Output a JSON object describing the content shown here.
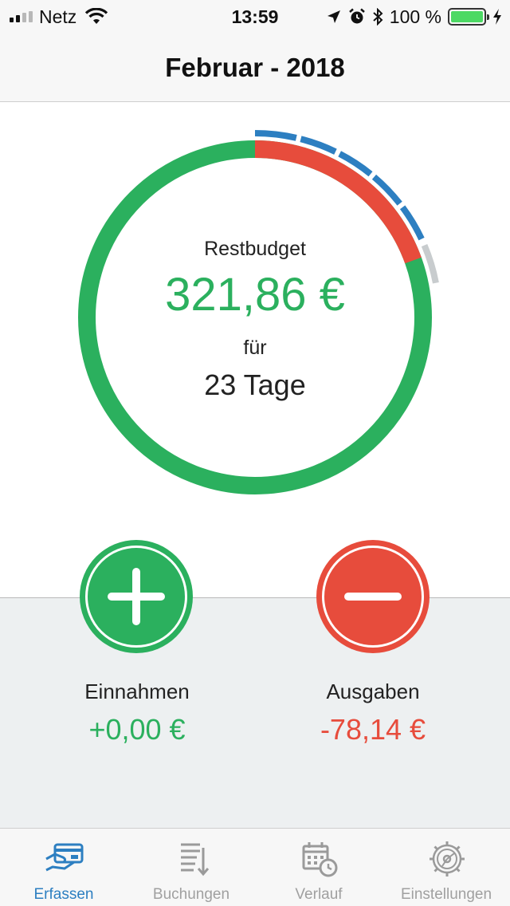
{
  "status_bar": {
    "carrier": "Netz",
    "time": "13:59",
    "battery_text": "100 %",
    "signal_bars": 4,
    "signal_bars_active": 2,
    "icons": [
      "signal-icon",
      "wifi-icon",
      "location-arrow-icon",
      "alarm-icon",
      "bluetooth-icon",
      "battery-icon",
      "charging-icon"
    ]
  },
  "header": {
    "title": "Februar - 2018"
  },
  "gauge": {
    "label": "Restbudget",
    "amount": "321,86 €",
    "for_label": "für",
    "days": "23 Tage",
    "spent_fraction": 0.195,
    "time_elapsed_fraction": 0.18,
    "colors": {
      "remaining": "#2bb05e",
      "spent": "#e74c3c",
      "elapsed": "#2d7fc1",
      "track": "#c8ccce"
    }
  },
  "income": {
    "label": "Einnahmen",
    "value": "+0,00 €",
    "button_icon": "plus-icon",
    "color": "#2bb05e"
  },
  "expenses": {
    "label": "Ausgaben",
    "value": "-78,14 €",
    "button_icon": "minus-icon",
    "color": "#e74c3c"
  },
  "tabs": [
    {
      "label": "Erfassen",
      "icon": "card-hand-icon",
      "active": true
    },
    {
      "label": "Buchungen",
      "icon": "list-sort-icon",
      "active": false
    },
    {
      "label": "Verlauf",
      "icon": "calendar-clock-icon",
      "active": false
    },
    {
      "label": "Einstellungen",
      "icon": "gear-icon",
      "active": false
    }
  ],
  "accent_color": "#2d7fc1"
}
